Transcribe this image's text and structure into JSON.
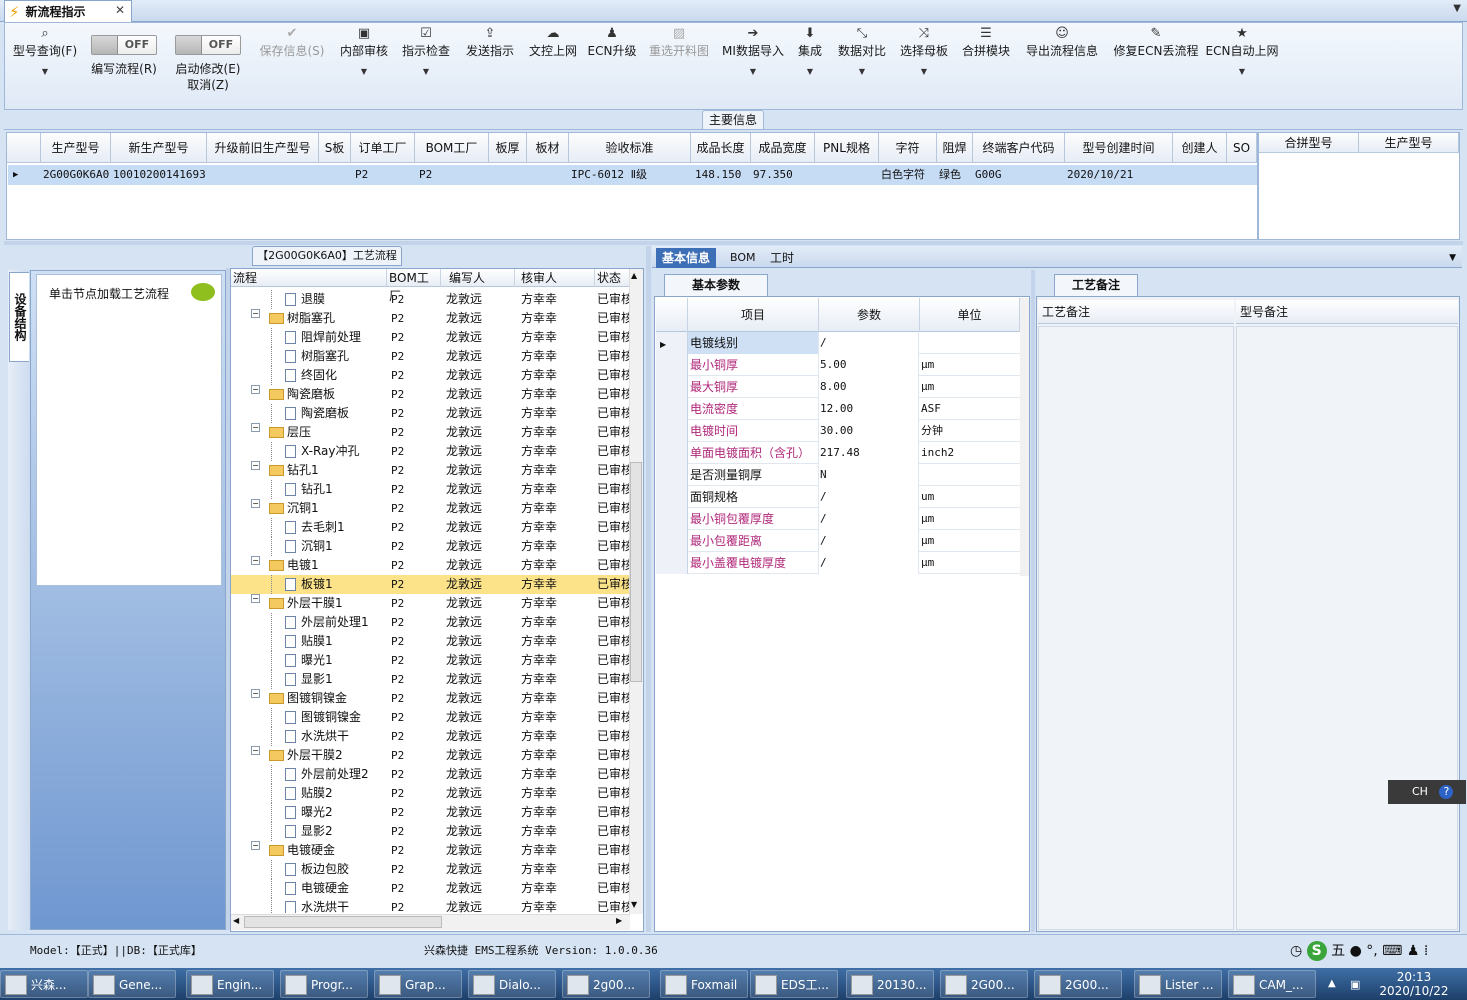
{
  "app": {
    "tab_title": "新流程指示",
    "tab_close": "✕",
    "tab_menu": "▼"
  },
  "toolbar": [
    {
      "label": "型号查询(F)",
      "icon": "⌕",
      "dropdown": true
    },
    {
      "label": "编写流程(R)",
      "toggle": "OFF"
    },
    {
      "label": "启动修改(E)",
      "label2": "取消(Z)",
      "toggle": "OFF"
    },
    {
      "label": "保存信息(S)",
      "icon": "✔",
      "disabled": true
    },
    {
      "label": "内部审核",
      "icon": "▣",
      "dropdown": true
    },
    {
      "label": "指示检查",
      "icon": "☑",
      "dropdown": true
    },
    {
      "label": "发送指示",
      "icon": "⇪"
    },
    {
      "label": "文控上网",
      "icon": "☁"
    },
    {
      "label": "ECN升级",
      "icon": "♟"
    },
    {
      "label": "重选开料图",
      "icon": "▨",
      "disabled": true
    },
    {
      "label": "MI数据导入",
      "icon": "➔",
      "dropdown": true
    },
    {
      "label": "集成",
      "icon": "⬇",
      "dropdown": true
    },
    {
      "label": "数据对比",
      "icon": "⤡",
      "dropdown": true
    },
    {
      "label": "选择母板",
      "icon": "⤨",
      "dropdown": true
    },
    {
      "label": "合拼模块",
      "icon": "☰"
    },
    {
      "label": "导出流程信息",
      "icon": "☺"
    },
    {
      "label": "修复ECN丢流程",
      "icon": "✎"
    },
    {
      "label": "ECN自动上网",
      "icon": "★",
      "dropdown": true
    }
  ],
  "main_info": {
    "title": "主要信息",
    "columns": [
      "生产型号",
      "新生产型号",
      "升级前旧生产型号",
      "S板",
      "订单工厂",
      "BOM工厂",
      "板厚",
      "板材",
      "验收标准",
      "成品长度",
      "成品宽度",
      "PNL规格",
      "字符",
      "阻焊",
      "终端客户代码",
      "型号创建时间",
      "创建人",
      "SO"
    ],
    "row": [
      "2G00G0K6A0",
      "10010200141693",
      "",
      "",
      "P2",
      "P2",
      "",
      "",
      "IPC-6012 Ⅱ级",
      "148.150",
      "97.350",
      "",
      "白色字符",
      "绿色",
      "G00G",
      "2020/10/21",
      "",
      ""
    ],
    "merge_columns": [
      "合拼型号",
      "生产型号"
    ]
  },
  "left_panel": {
    "tab": "设备结构",
    "hint": "单击节点加载工艺流程"
  },
  "tree": {
    "title": "【2G00G0K6A0】工艺流程",
    "columns": [
      "流程",
      "BOM工厂",
      "编写人",
      "核审人",
      "状态"
    ],
    "rows": [
      {
        "name": "退膜",
        "level": 1,
        "bom": "P2",
        "writer": "龙敦远",
        "reviewer": "方幸幸",
        "status": "已审核"
      },
      {
        "name": "树脂塞孔",
        "level": 0,
        "bom": "P2",
        "writer": "龙敦远",
        "reviewer": "方幸幸",
        "status": "已审核"
      },
      {
        "name": "阻焊前处理",
        "level": 1,
        "bom": "P2",
        "writer": "龙敦远",
        "reviewer": "方幸幸",
        "status": "已审核"
      },
      {
        "name": "树脂塞孔",
        "level": 1,
        "bom": "P2",
        "writer": "龙敦远",
        "reviewer": "方幸幸",
        "status": "已审核"
      },
      {
        "name": "终固化",
        "level": 1,
        "bom": "P2",
        "writer": "龙敦远",
        "reviewer": "方幸幸",
        "status": "已审核"
      },
      {
        "name": "陶瓷磨板",
        "level": 0,
        "bom": "P2",
        "writer": "龙敦远",
        "reviewer": "方幸幸",
        "status": "已审核"
      },
      {
        "name": "陶瓷磨板",
        "level": 1,
        "bom": "P2",
        "writer": "龙敦远",
        "reviewer": "方幸幸",
        "status": "已审核"
      },
      {
        "name": "层压",
        "level": 0,
        "bom": "P2",
        "writer": "龙敦远",
        "reviewer": "方幸幸",
        "status": "已审核"
      },
      {
        "name": "X-Ray冲孔",
        "level": 1,
        "bom": "P2",
        "writer": "龙敦远",
        "reviewer": "方幸幸",
        "status": "已审核"
      },
      {
        "name": "钻孔1",
        "level": 0,
        "bom": "P2",
        "writer": "龙敦远",
        "reviewer": "方幸幸",
        "status": "已审核"
      },
      {
        "name": "钻孔1",
        "level": 1,
        "bom": "P2",
        "writer": "龙敦远",
        "reviewer": "方幸幸",
        "status": "已审核"
      },
      {
        "name": "沉铜1",
        "level": 0,
        "bom": "P2",
        "writer": "龙敦远",
        "reviewer": "方幸幸",
        "status": "已审核"
      },
      {
        "name": "去毛刺1",
        "level": 1,
        "bom": "P2",
        "writer": "龙敦远",
        "reviewer": "方幸幸",
        "status": "已审核"
      },
      {
        "name": "沉铜1",
        "level": 1,
        "bom": "P2",
        "writer": "龙敦远",
        "reviewer": "方幸幸",
        "status": "已审核"
      },
      {
        "name": "电镀1",
        "level": 0,
        "bom": "P2",
        "writer": "龙敦远",
        "reviewer": "方幸幸",
        "status": "已审核"
      },
      {
        "name": "板镀1",
        "level": 1,
        "bom": "P2",
        "writer": "龙敦远",
        "reviewer": "方幸幸",
        "status": "已审核",
        "selected": true
      },
      {
        "name": "外层干膜1",
        "level": 0,
        "bom": "P2",
        "writer": "龙敦远",
        "reviewer": "方幸幸",
        "status": "已审核"
      },
      {
        "name": "外层前处理1",
        "level": 1,
        "bom": "P2",
        "writer": "龙敦远",
        "reviewer": "方幸幸",
        "status": "已审核"
      },
      {
        "name": "贴膜1",
        "level": 1,
        "bom": "P2",
        "writer": "龙敦远",
        "reviewer": "方幸幸",
        "status": "已审核"
      },
      {
        "name": "曝光1",
        "level": 1,
        "bom": "P2",
        "writer": "龙敦远",
        "reviewer": "方幸幸",
        "status": "已审核"
      },
      {
        "name": "显影1",
        "level": 1,
        "bom": "P2",
        "writer": "龙敦远",
        "reviewer": "方幸幸",
        "status": "已审核"
      },
      {
        "name": "图镀铜镍金",
        "level": 0,
        "bom": "P2",
        "writer": "龙敦远",
        "reviewer": "方幸幸",
        "status": "已审核"
      },
      {
        "name": "图镀铜镍金",
        "level": 1,
        "bom": "P2",
        "writer": "龙敦远",
        "reviewer": "方幸幸",
        "status": "已审核"
      },
      {
        "name": "水洗烘干",
        "level": 1,
        "bom": "P2",
        "writer": "龙敦远",
        "reviewer": "方幸幸",
        "status": "已审核"
      },
      {
        "name": "外层干膜2",
        "level": 0,
        "bom": "P2",
        "writer": "龙敦远",
        "reviewer": "方幸幸",
        "status": "已审核"
      },
      {
        "name": "外层前处理2",
        "level": 1,
        "bom": "P2",
        "writer": "龙敦远",
        "reviewer": "方幸幸",
        "status": "已审核"
      },
      {
        "name": "贴膜2",
        "level": 1,
        "bom": "P2",
        "writer": "龙敦远",
        "reviewer": "方幸幸",
        "status": "已审核"
      },
      {
        "name": "曝光2",
        "level": 1,
        "bom": "P2",
        "writer": "龙敦远",
        "reviewer": "方幸幸",
        "status": "已审核"
      },
      {
        "name": "显影2",
        "level": 1,
        "bom": "P2",
        "writer": "龙敦远",
        "reviewer": "方幸幸",
        "status": "已审核"
      },
      {
        "name": "电镀硬金",
        "level": 0,
        "bom": "P2",
        "writer": "龙敦远",
        "reviewer": "方幸幸",
        "status": "已审核"
      },
      {
        "name": "板边包胶",
        "level": 1,
        "bom": "P2",
        "writer": "龙敦远",
        "reviewer": "方幸幸",
        "status": "已审核"
      },
      {
        "name": "电镀硬金",
        "level": 1,
        "bom": "P2",
        "writer": "龙敦远",
        "reviewer": "方幸幸",
        "status": "已审核"
      },
      {
        "name": "水洗烘干",
        "level": 1,
        "bom": "P2",
        "writer": "龙敦远",
        "reviewer": "方幸幸",
        "status": "已审核"
      }
    ]
  },
  "right_tabs": [
    "基本信息",
    "BOM",
    "工时"
  ],
  "basic_params": {
    "title": "基本参数",
    "columns": [
      "项目",
      "参数",
      "单位"
    ],
    "rows": [
      {
        "item": "电镀线别",
        "value": "/",
        "unit": "",
        "pink": false,
        "current": true
      },
      {
        "item": "最小铜厚",
        "value": "5.00",
        "unit": "μm",
        "pink": true
      },
      {
        "item": "最大铜厚",
        "value": "8.00",
        "unit": "μm",
        "pink": true
      },
      {
        "item": "电流密度",
        "value": "12.00",
        "unit": "ASF",
        "pink": true
      },
      {
        "item": "电镀时间",
        "value": "30.00",
        "unit": "分钟",
        "pink": true
      },
      {
        "item": "单面电镀面积（含孔）",
        "value": "217.48",
        "unit": "inch2",
        "pink": true
      },
      {
        "item": "是否测量铜厚",
        "value": "N",
        "unit": "",
        "pink": false
      },
      {
        "item": "面铜规格",
        "value": "/",
        "unit": "um",
        "pink": false
      },
      {
        "item": "最小铜包覆厚度",
        "value": "/",
        "unit": "μm",
        "pink": true
      },
      {
        "item": "最小包覆距离",
        "value": "/",
        "unit": "μm",
        "pink": true
      },
      {
        "item": "最小盖覆电镀厚度",
        "value": "/",
        "unit": "μm",
        "pink": true
      }
    ]
  },
  "remarks": {
    "title": "工艺备注",
    "col1": "工艺备注",
    "col2": "型号备注"
  },
  "status_bar": {
    "model": "Model:【正式】||DB:【正式库】",
    "system": "兴森快捷 EMS工程系统 Version: 1.0.0.36"
  },
  "ime": "CH",
  "taskbar": [
    "兴森...",
    "Gene...",
    "Engin...",
    "Progr...",
    "Grap...",
    "Dialo...",
    "2g00...",
    "Foxmail",
    "EDS工...",
    "20130...",
    "2G00...",
    "2G00...",
    "Lister ...",
    "CAM_..."
  ],
  "clock": {
    "time": "20:13",
    "date": "2020/10/22"
  },
  "colors": {
    "accent": "#3d6fb6",
    "selected_row": "#fce38a",
    "pink_text": "#b0287a"
  }
}
